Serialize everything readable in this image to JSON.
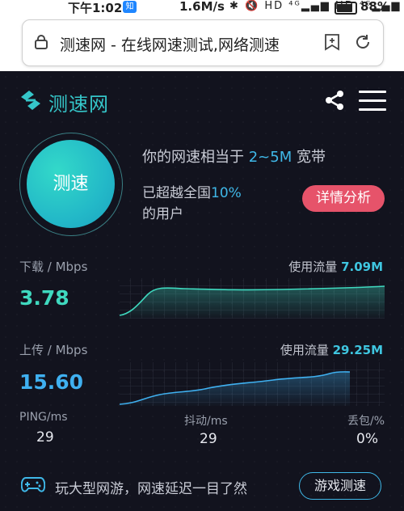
{
  "status_bar": {
    "time": "下午1:02",
    "app_icon_text": "知",
    "network_speed": "1.6M/s",
    "signal_text": "✱ 🔇 HD ⁴ᴳ▂▄▆ HD ⁴ᴳ▂▄▆",
    "battery": "88%"
  },
  "browser": {
    "page_title": "测速网 - 在线网速测试,网络测速"
  },
  "app": {
    "brand_name": "测速网",
    "accent_color": "#35c6c9",
    "speed_button_label": "测速",
    "equivalent_prefix": "你的网速相当于 ",
    "equivalent_value": "2~5M",
    "equivalent_suffix": " 宽带",
    "beat_prefix": "已超越全国",
    "beat_percent": "10%",
    "beat_suffix": "的用户",
    "detail_button": "详情分析",
    "download": {
      "label": "下载 / Mbps",
      "speed": "3.78",
      "usage_label": "使用流量 ",
      "usage_value": "7.09M",
      "color": "#3fd9bf"
    },
    "upload": {
      "label": "上传 / Mbps",
      "speed": "15.60",
      "usage_label": "使用流量 ",
      "usage_value": "29.25M",
      "color": "#3fb0f0"
    },
    "ping": {
      "label": "PING/ms",
      "value": "29"
    },
    "jitter": {
      "label": "抖动/ms",
      "value": "29"
    },
    "loss": {
      "label": "丢包/%",
      "value": "0%"
    },
    "game_text": "玩大型网游，网速延迟一目了然",
    "game_button": "游戏测速"
  }
}
